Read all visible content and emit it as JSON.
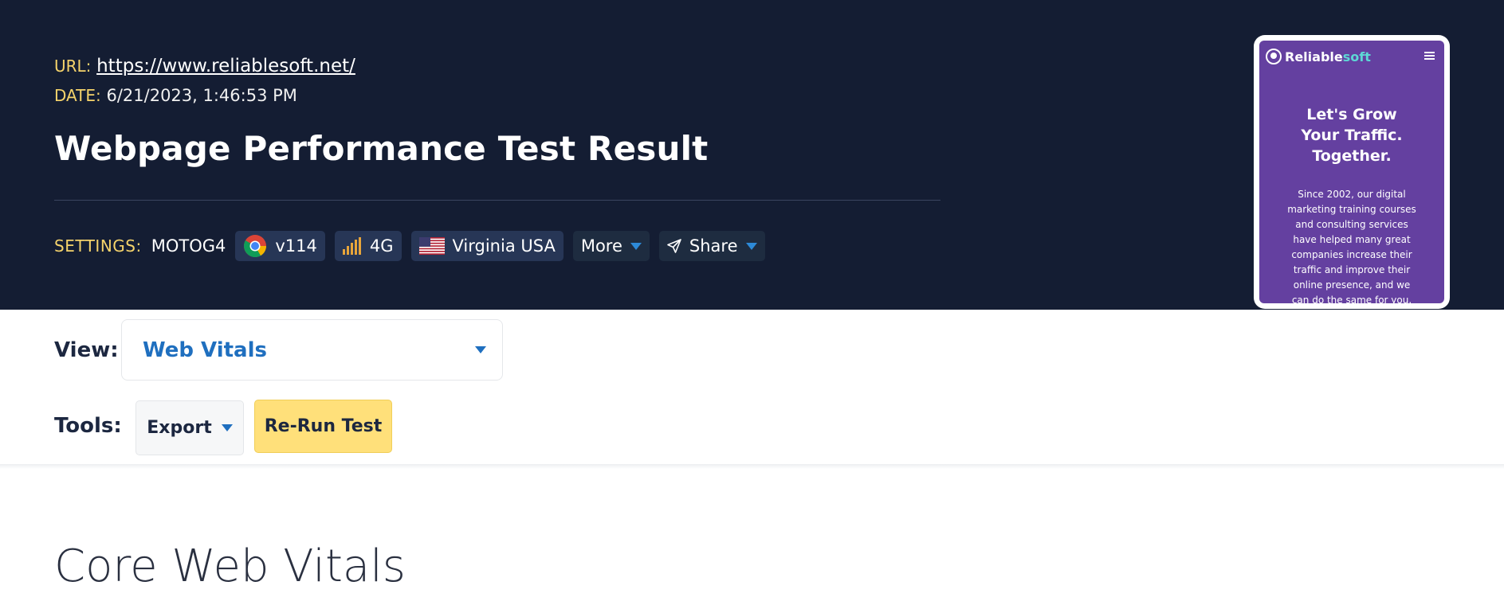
{
  "header": {
    "url_label": "URL:",
    "url_value": "https://www.reliablesoft.net/",
    "date_label": "DATE:",
    "date_value": "6/21/2023, 1:46:53 PM",
    "title": "Webpage Performance Test Result",
    "settings_label": "SETTINGS:",
    "device": "MOTOG4",
    "browser_version": "v114",
    "connection": "4G",
    "location": "Virginia USA",
    "more_label": "More",
    "share_label": "Share"
  },
  "preview": {
    "logo_main": "Reliable",
    "logo_accent": "soft",
    "headline_line1": "Let's Grow",
    "headline_line2": "Your Traffic.",
    "headline_line3": "Together.",
    "body_lines": [
      "Since 2002, our digital",
      "marketing training courses",
      "and consulting services",
      "have helped many great",
      "companies increase their",
      "traffic and improve their",
      "online presence, and we",
      "can do the same for you."
    ]
  },
  "view": {
    "label": "View:",
    "selected": "Web Vitals"
  },
  "tools": {
    "label": "Tools:",
    "export_label": "Export",
    "rerun_label": "Re-Run Test"
  },
  "section": {
    "title": "Core Web Vitals"
  },
  "colors": {
    "header_bg": "#141d33",
    "accent_yellow": "#f5d36b",
    "link_blue": "#1f6fbf",
    "button_yellow": "#ffe07a",
    "preview_purple": "#6440a0"
  }
}
